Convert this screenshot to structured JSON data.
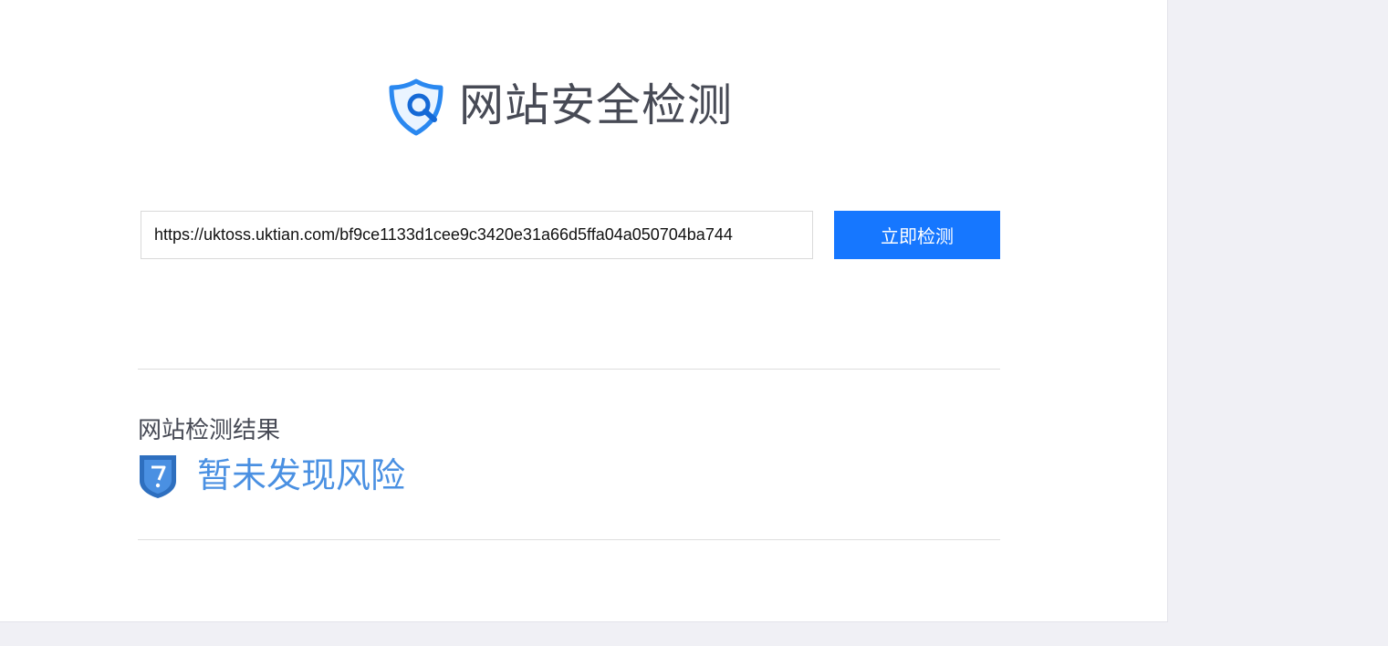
{
  "brand": {
    "title": "网站安全检测",
    "icon": "shield-search-icon"
  },
  "search": {
    "url_value": "https://uktoss.uktian.com/bf9ce1133d1cee9c3420e31a66d5ffa04a050704ba744",
    "button_label": "立即检测"
  },
  "result": {
    "heading": "网站检测结果",
    "status": "暂未发现风险",
    "icon": "shield-check-icon"
  },
  "colors": {
    "primary": "#1677ff",
    "status": "#4a90e2",
    "text": "#474a55"
  }
}
